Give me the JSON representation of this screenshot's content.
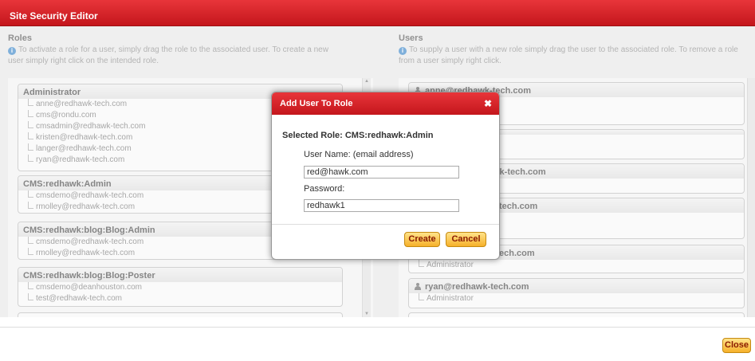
{
  "window": {
    "title": "Site Security Editor"
  },
  "roles_panel": {
    "title": "Roles",
    "hint": "To activate a role for a user, simply drag the role to the associated user. To create a new user simply right click on the intended role.",
    "roles": [
      {
        "name": "Administrator",
        "users": [
          "anne@redhawk-tech.com",
          "cms@rondu.com",
          "cmsadmin@redhawk-tech.com",
          "kristen@redhawk-tech.com",
          "langer@redhawk-tech.com",
          "ryan@redhawk-tech.com"
        ]
      },
      {
        "name": "CMS:redhawk:Admin",
        "users": [
          "cmsdemo@redhawk-tech.com",
          "rmolley@redhawk-tech.com"
        ]
      },
      {
        "name": "CMS:redhawk:blog:Blog:Admin",
        "users": [
          "cmsdemo@redhawk-tech.com",
          "rmolley@redhawk-tech.com"
        ]
      },
      {
        "name": "CMS:redhawk:blog:Blog:Poster",
        "users": [
          "cmsdemo@deanhouston.com",
          "test@redhawk-tech.com"
        ]
      }
    ]
  },
  "users_panel": {
    "title": "Users",
    "hint": "To supply a user with a new role simply drag the user to the associated role. To remove a role from a user simply right click.",
    "users": [
      {
        "email": "anne@redhawk-tech.com",
        "roles": []
      },
      {
        "email": "",
        "roles": []
      },
      {
        "email": "wk-tech.com",
        "roles": []
      },
      {
        "email": "tech.com",
        "roles": []
      },
      {
        "email": "ech.com",
        "roles": [
          "Administrator"
        ]
      },
      {
        "email": "ryan@redhawk-tech.com",
        "roles": [
          "Administrator"
        ]
      }
    ]
  },
  "dialog": {
    "title": "Add User To Role",
    "close_glyph": "✖",
    "selected_role": "Selected Role: CMS:redhawk:Admin",
    "username_label": "User Name: (email address)",
    "username_value": "red@hawk.com",
    "password_label": "Password:",
    "password_value": "redhawk1",
    "create_label": "Create",
    "cancel_label": "Cancel"
  },
  "footer": {
    "close_label": "Close"
  },
  "colors": {
    "header_red": "#d42128",
    "button_orange": "#f6b02a",
    "info_blue": "#3b86c8"
  }
}
